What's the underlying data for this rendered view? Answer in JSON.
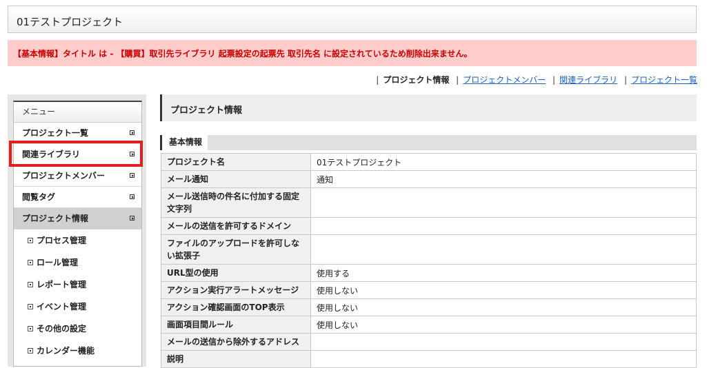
{
  "header": {
    "title": "01テストプロジェクト"
  },
  "error": {
    "message": "【基本情報】タイトル は - 【購買】取引先ライブラリ 起票設定の起票先 取引先名 に設定されているため削除出来ません。"
  },
  "topnav": {
    "current": "プロジェクト情報",
    "links": [
      "プロジェクトメンバー",
      "関連ライブラリ",
      "プロジェクト一覧"
    ]
  },
  "sidebar": {
    "head": "メニュー",
    "items": [
      "プロジェクト一覧",
      "関連ライブラリ",
      "プロジェクトメンバー",
      "閲覧タグ",
      "プロジェクト情報"
    ],
    "subitems": [
      "プロセス管理",
      "ロール管理",
      "レポート管理",
      "イベント管理",
      "その他の設定",
      "カレンダー機能"
    ]
  },
  "panel": {
    "title": "プロジェクト情報",
    "section": "基本情報"
  },
  "rows": [
    {
      "k": "プロジェクト名",
      "v": "01テストプロジェクト"
    },
    {
      "k": "メール通知",
      "v": "通知"
    },
    {
      "k": "メール送信時の件名に付加する固定文字列",
      "v": ""
    },
    {
      "k": "メールの送信を許可するドメイン",
      "v": ""
    },
    {
      "k": "ファイルのアップロードを許可しない拡張子",
      "v": ""
    },
    {
      "k": "URL型の使用",
      "v": "使用する"
    },
    {
      "k": "アクション実行アラートメッセージ",
      "v": "使用しない"
    },
    {
      "k": "アクション確認画面のTOP表示",
      "v": "使用しない"
    },
    {
      "k": "画面項目間ルール",
      "v": "使用しない"
    },
    {
      "k": "メールの送信から除外するアドレス",
      "v": ""
    },
    {
      "k": "説明",
      "v": ""
    }
  ],
  "colors": {
    "error_bg": "#ffcccc",
    "error_text": "#cc0000",
    "highlight": "#e02020",
    "link": "#1a5fc4"
  }
}
